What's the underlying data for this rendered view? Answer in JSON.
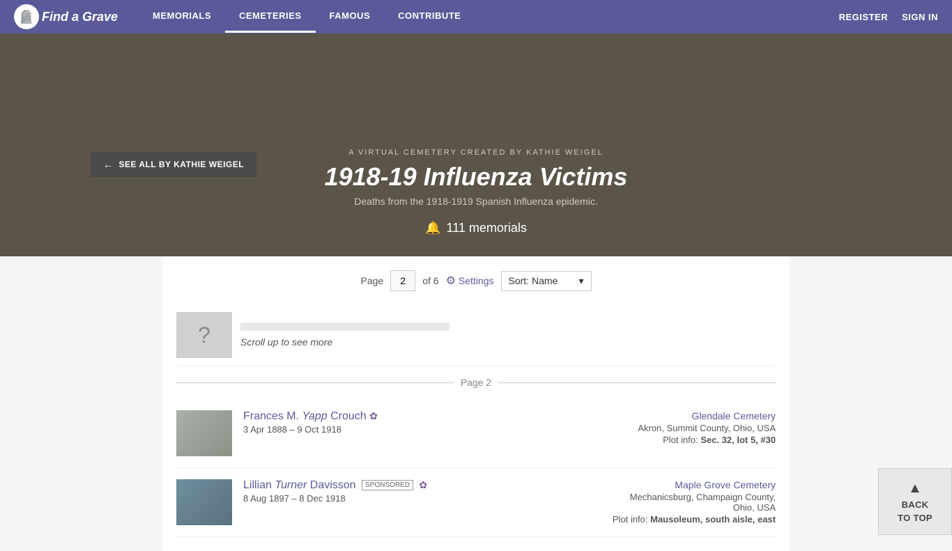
{
  "nav": {
    "logo_text": "Find a Grave",
    "logo_icon": "🪦",
    "links": [
      {
        "label": "MEMORIALS",
        "active": false
      },
      {
        "label": "CEMETERIES",
        "active": true
      },
      {
        "label": "FAMOUS",
        "active": false
      },
      {
        "label": "CONTRIBUTE",
        "active": false
      }
    ],
    "right_links": [
      {
        "label": "REGISTER"
      },
      {
        "label": "SIGN IN"
      }
    ]
  },
  "hero": {
    "see_all_label": "SEE ALL BY KATHIE WEIGEL",
    "subtitle": "A VIRTUAL CEMETERY CREATED BY KATHIE WEIGEL",
    "title": "1918-19 Influenza Victims",
    "description": "Deaths from the 1918-1919 Spanish Influenza epidemic.",
    "count": "111 memorials"
  },
  "pagination": {
    "label": "Page",
    "current_page": "2",
    "total": "6",
    "settings_label": "Settings",
    "sort_label": "Sort: Name"
  },
  "scroll_up": {
    "text": "Scroll up to see more"
  },
  "page_divider": {
    "label": "Page 2"
  },
  "memorials": [
    {
      "id": "frances",
      "name_prefix": "Frances M.",
      "name_italic": "Yapp",
      "name_suffix": "Crouch",
      "has_flower": true,
      "dates": "3 Apr 1888 – 9 Oct 1918",
      "sponsored": false,
      "cemetery_name": "Glendale Cemetery",
      "cemetery_location": "Akron, Summit County, Ohio, USA",
      "plot_label": "Plot info:",
      "plot_value": "Sec. 32, lot 5, #30",
      "thumb_type": "stone"
    },
    {
      "id": "lillian",
      "name_prefix": "Lillian",
      "name_italic": "Turner",
      "name_suffix": "Davisson",
      "has_flower": true,
      "dates": "8 Aug 1897 – 8 Dec 1918",
      "sponsored": true,
      "sponsored_label": "SPONSORED",
      "cemetery_name": "Maple Grove Cemetery",
      "cemetery_location": "Mechanicsburg, Champaign County,\nOhio, USA",
      "plot_label": "Plot info:",
      "plot_value": "Mausoleum, south aisle, east",
      "thumb_type": "building"
    }
  ],
  "back_to_top": {
    "label1": "BACK",
    "label2": "TO TOP"
  }
}
